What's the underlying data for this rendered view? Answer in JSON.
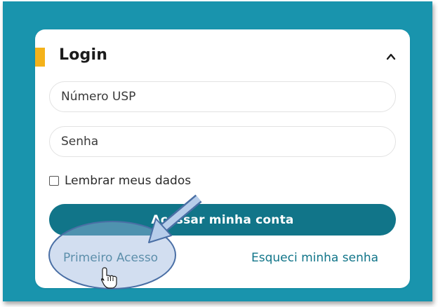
{
  "login": {
    "title": "Login",
    "username_placeholder": "Número USP",
    "password_placeholder": "Senha",
    "remember_label": "Lembrar meus dados",
    "submit_label": "Acessar minha conta",
    "first_access_label": "Primeiro Acesso",
    "forgot_password_label": "Esqueci minha senha"
  },
  "icons": {
    "collapse": "chevron-up-icon",
    "pointer": "hand-cursor-icon",
    "callout": "arrow-icon"
  },
  "colors": {
    "background": "#1994ad",
    "accent": "#f4b21a",
    "button": "#117589",
    "link": "#117589",
    "highlight": "#9bb6dd",
    "highlight_border": "#4a6fa5"
  }
}
